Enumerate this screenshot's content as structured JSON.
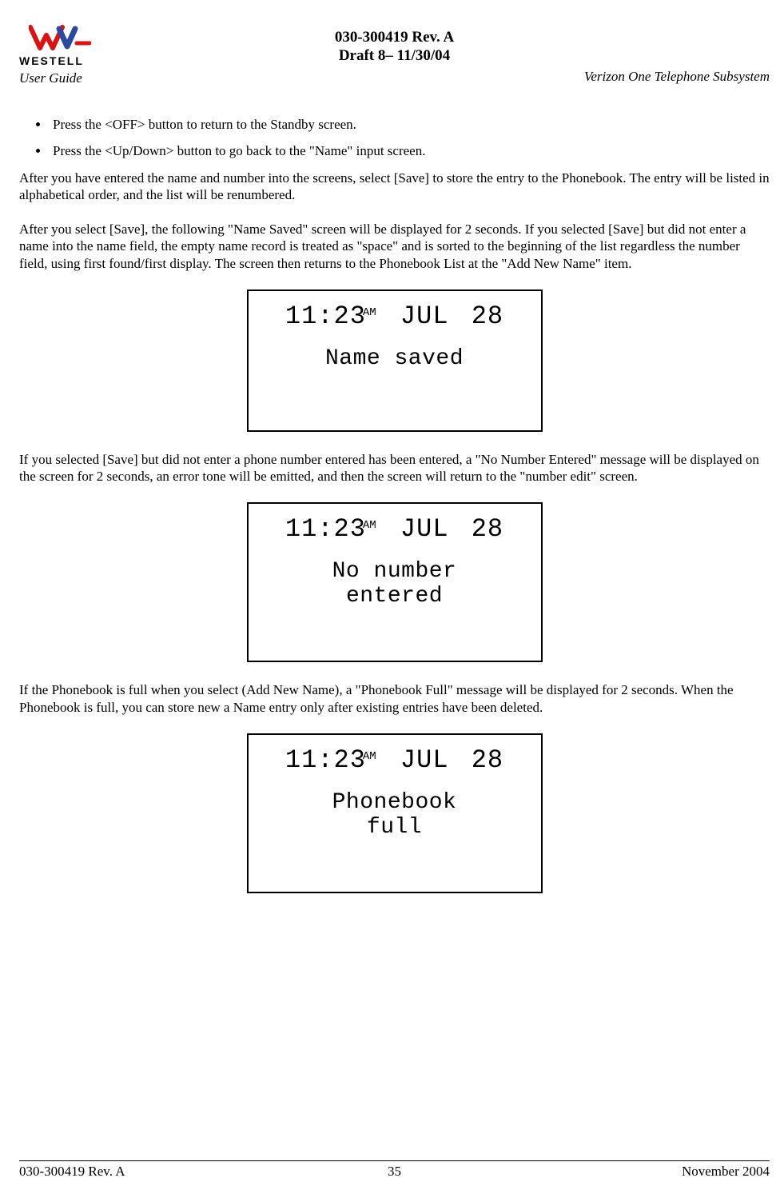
{
  "header": {
    "logo_brand": "WESTELL",
    "doc_id": "030-300419 Rev. A",
    "draft": "Draft 8– 11/30/04",
    "left_label": "User Guide",
    "right_label": "Verizon One Telephone Subsystem"
  },
  "bullets": [
    "Press the <OFF> button to return to the Standby screen.",
    "Press the <Up/Down> button to go back to the \"Name\" input screen."
  ],
  "paragraphs": {
    "p1": "After you have entered the name and number into the screens, select [Save] to store the entry to the Phonebook. The entry will be listed in alphabetical order, and the list will be renumbered.",
    "p2": "After you select [Save], the following \"Name Saved\" screen will be displayed for 2 seconds. If you selected [Save] but did not enter a name into the name field, the empty name record is treated as \"space\" and is sorted to the beginning of the list regardless the number field, using first found/first display. The screen then returns to the Phonebook List at the \"Add New Name\" item.",
    "p3": "If you selected [Save] but did not enter a phone number entered has been entered, a \"No Number Entered\" message will be displayed on the screen for 2 seconds, an error tone will be emitted, and then the screen will return to the \"number edit\" screen.",
    "p4": "If the Phonebook is full when you select (Add New Name), a \"Phonebook Full\" message will be displayed for 2 seconds. When the Phonebook is full, you can store new a Name entry only after existing entries have been deleted."
  },
  "lcd": {
    "time": "11:23",
    "ampm": "AM",
    "date": "JUL 28",
    "msg1": "Name saved",
    "msg2_line1": "No number",
    "msg2_line2": "entered",
    "msg3_line1": "Phonebook",
    "msg3_line2": "full"
  },
  "footer": {
    "left": "030-300419 Rev. A",
    "center": "35",
    "right": "November 2004"
  }
}
